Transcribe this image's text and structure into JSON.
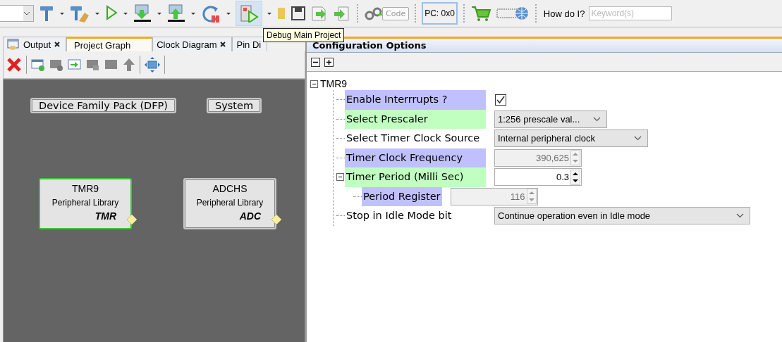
{
  "toolbar": {
    "code_label": "Code",
    "pc_label": "PC: 0x0",
    "help_label": "How do I?",
    "search": {
      "placeholder": "Keyword(s)"
    }
  },
  "tooltip": "Debug Main Project",
  "left_tabs": [
    {
      "label": "Output",
      "selected": false,
      "closable": true
    },
    {
      "label": "Project Graph",
      "selected": true,
      "closable": false
    },
    {
      "label": "Clock Diagram",
      "selected": false,
      "closable": true
    },
    {
      "label": "Pin Di",
      "selected": false,
      "closable": false
    }
  ],
  "graph": {
    "nodes": [
      {
        "kind": "group",
        "label": "Device Family Pack (DFP)"
      },
      {
        "kind": "group",
        "label": "System"
      },
      {
        "kind": "component",
        "name": "TMR9",
        "subtitle": "Peripheral Library",
        "tag": "TMR",
        "selected": true
      },
      {
        "kind": "component",
        "name": "ADCHS",
        "subtitle": "Peripheral Library",
        "tag": "ADC",
        "selected": false
      }
    ]
  },
  "config": {
    "title": "Configuration Options",
    "tree": {
      "label": "TMR9",
      "expanded": true,
      "children": [
        {
          "label": "Enable Interrrupts ?",
          "color": "#c0c0ff",
          "kind": "checkbox",
          "checked": true
        },
        {
          "label": "Select Prescaler",
          "color": "#c0ffc0",
          "kind": "combo",
          "value": "1:256 prescale val..."
        },
        {
          "label": "Select Timer Clock Source",
          "kind": "combo",
          "value": "Internal peripheral clock"
        },
        {
          "label": "Timer Clock Frequency",
          "color": "#c0c0ff",
          "kind": "spinner",
          "value": "390,625",
          "disabled": true
        },
        {
          "label": "Timer Period (Milli Sec)",
          "color": "#c0ffc0",
          "kind": "spinner",
          "value": "0.3",
          "disabled": false,
          "expanded": true,
          "children": [
            {
              "label": "Period Register",
              "color": "#c0c0ff",
              "kind": "spinner",
              "value": "116",
              "disabled": true
            }
          ]
        },
        {
          "label": "Stop in Idle Mode bit",
          "kind": "combo",
          "value": "Continue operation even in Idle mode"
        }
      ]
    }
  }
}
